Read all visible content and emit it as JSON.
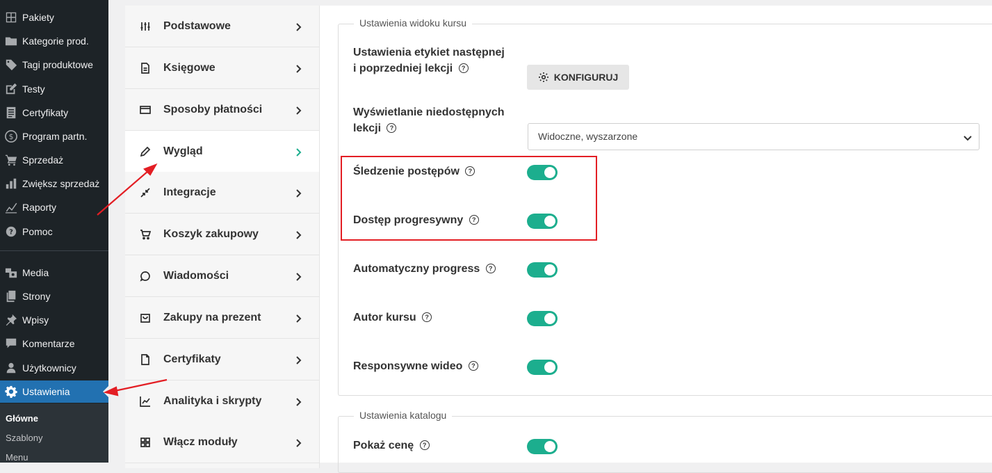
{
  "wp_menu": [
    {
      "label": "Pakiety",
      "icon": "grid-icon"
    },
    {
      "label": "Kategorie prod.",
      "icon": "folder-icon"
    },
    {
      "label": "Tagi produktowe",
      "icon": "tag-icon"
    },
    {
      "label": "Testy",
      "icon": "edit-icon"
    },
    {
      "label": "Certyfikaty",
      "icon": "document-icon"
    },
    {
      "label": "Program partn.",
      "icon": "dollar-icon"
    },
    {
      "label": "Sprzedaż",
      "icon": "cart-icon"
    },
    {
      "label": "Zwiększ sprzedaż",
      "icon": "bar-chart-icon"
    },
    {
      "label": "Raporty",
      "icon": "line-chart-icon"
    },
    {
      "label": "Pomoc",
      "icon": "help-icon"
    },
    {
      "label": "Media",
      "icon": "media-icon"
    },
    {
      "label": "Strony",
      "icon": "pages-icon"
    },
    {
      "label": "Wpisy",
      "icon": "pin-icon"
    },
    {
      "label": "Komentarze",
      "icon": "comment-icon"
    },
    {
      "label": "Użytkownicy",
      "icon": "user-icon"
    },
    {
      "label": "Ustawienia",
      "icon": "settings-icon",
      "active": true
    }
  ],
  "wp_submenu": [
    {
      "label": "Główne",
      "current": true
    },
    {
      "label": "Szablony"
    },
    {
      "label": "Menu"
    }
  ],
  "settings_nav": [
    {
      "label": "Podstawowe",
      "icon": "sliders-icon"
    },
    {
      "label": "Księgowe",
      "icon": "file-text-icon"
    },
    {
      "label": "Sposoby płatności",
      "icon": "credit-card-icon"
    },
    {
      "label": "Wygląd",
      "icon": "pencil-icon",
      "active": true
    },
    {
      "label": "Integracje",
      "icon": "minimize-icon"
    },
    {
      "label": "Koszyk zakupowy",
      "icon": "shopping-cart-icon"
    },
    {
      "label": "Wiadomości",
      "icon": "message-icon"
    },
    {
      "label": "Zakupy na prezent",
      "icon": "shopping-bag-icon"
    },
    {
      "label": "Certyfikaty",
      "icon": "file-icon"
    },
    {
      "label": "Analityka i skrypty",
      "icon": "trend-icon"
    },
    {
      "label": "Włącz moduły",
      "icon": "modules-icon"
    }
  ],
  "course_view": {
    "legend": "Ustawienia widoku kursu",
    "labels_setting": {
      "line1": "Ustawienia etykiet następnej",
      "line2": "i poprzedniej lekcji",
      "button": "KONFIGURUJ"
    },
    "unavailable_lessons": {
      "line1": "Wyświetlanie niedostępnych",
      "line2": "lekcji",
      "value": "Widoczne, wyszarzone"
    },
    "toggles": [
      {
        "label": "Śledzenie postępów",
        "on": true
      },
      {
        "label": "Dostęp progresywny",
        "on": true
      },
      {
        "label": "Automatyczny progress",
        "on": true
      },
      {
        "label": "Autor kursu",
        "on": true
      },
      {
        "label": "Responsywne wideo",
        "on": true
      }
    ]
  },
  "catalog": {
    "legend": "Ustawienia katalogu",
    "toggles": [
      {
        "label": "Pokaż cenę",
        "on": true
      }
    ]
  },
  "colors": {
    "accent": "#1cae8e",
    "wp_sidebar": "#1d2327",
    "wp_active": "#2271b1",
    "annotation": "#e31e24"
  },
  "help_glyph": "?"
}
